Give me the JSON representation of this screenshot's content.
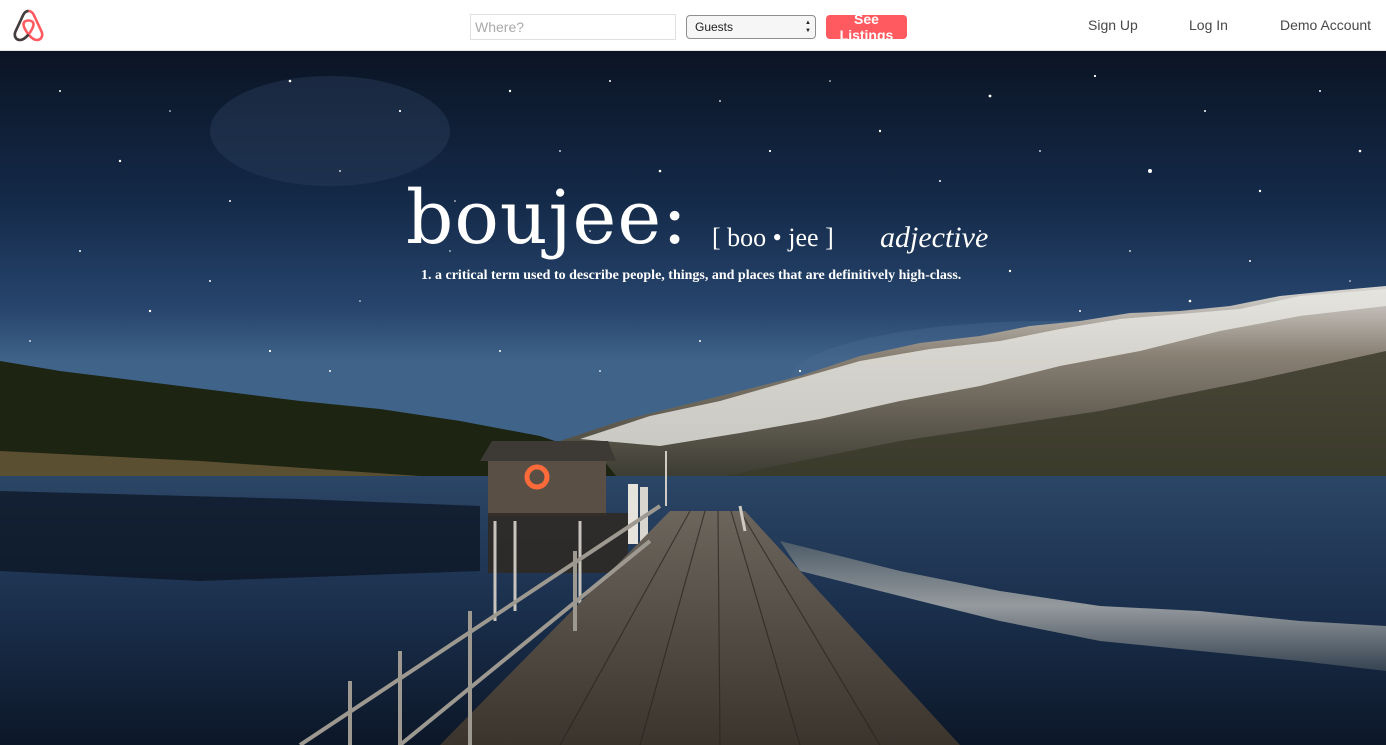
{
  "brand": {
    "logo_icon": "airbnb-belo-icon",
    "accent_color": "#ff5a5f"
  },
  "search": {
    "where_placeholder": "Where?",
    "guests_selected": "Guests",
    "submit_label": "See Listings"
  },
  "nav": {
    "signup_label": "Sign Up",
    "login_label": "Log In",
    "demo_label": "Demo Account"
  },
  "hero": {
    "background": "starry-night-lake-pier-mountains",
    "word": "boujee:",
    "pronunciation": "[ boo • jee ]",
    "part_of_speech": "adjective",
    "definition": "1. a critical term used to describe people, things, and places that are definitively high-class."
  }
}
